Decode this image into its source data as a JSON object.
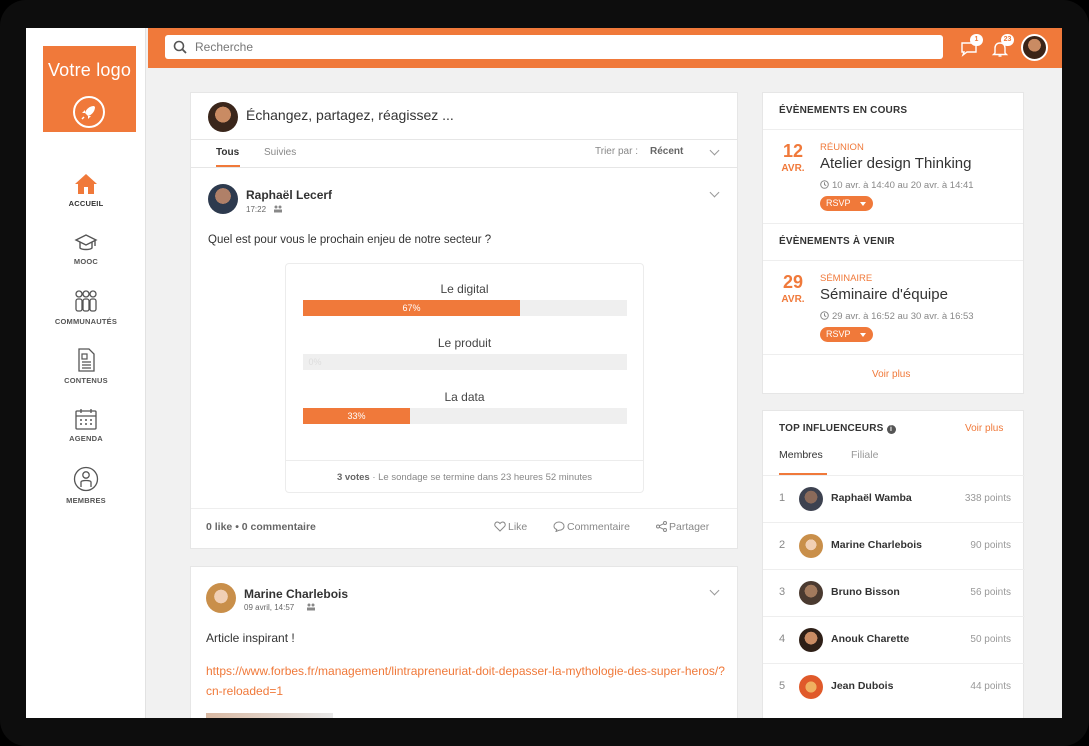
{
  "colors": {
    "accent": "#f0793a",
    "background": "#f1f1f1"
  },
  "sidebar": {
    "logo_text": "Votre logo",
    "logo_icon": "rocket-icon",
    "items": [
      {
        "label": "ACCUEIL",
        "icon": "home-icon",
        "active": true
      },
      {
        "label": "MOOC",
        "icon": "graduation-cap-icon"
      },
      {
        "label": "COMMUNAUTÉS",
        "icon": "people-icon"
      },
      {
        "label": "CONTENUS",
        "icon": "document-icon"
      },
      {
        "label": "AGENDA",
        "icon": "calendar-icon"
      },
      {
        "label": "MEMBRES",
        "icon": "user-icon"
      }
    ]
  },
  "topbar": {
    "search_placeholder": "Recherche",
    "messages_badge": "1",
    "notifications_badge": "23"
  },
  "composer": {
    "prompt": "Échangez, partagez, réagissez ..."
  },
  "feed_tabs": {
    "tabs": [
      "Tous",
      "Suivies"
    ],
    "active": "Tous",
    "sort_label": "Trier par :",
    "sort_value": "Récent"
  },
  "post1": {
    "author": "Raphaël Lecerf",
    "time": "17:22",
    "question": "Quel est pour vous le prochain enjeu de notre secteur ?",
    "poll": {
      "options": [
        {
          "label": "Le digital",
          "percent": 67,
          "percent_label": "67%"
        },
        {
          "label": "Le produit",
          "percent": 0,
          "percent_label": "0%"
        },
        {
          "label": "La data",
          "percent": 33,
          "percent_label": "33%"
        }
      ],
      "votes": "3 votes",
      "footer": " · Le sondage se termine dans 23 heures 52 minutes"
    },
    "stats": "0 like • 0 commentaire",
    "actions": {
      "like": "Like",
      "comment": "Commentaire",
      "share": "Partager"
    }
  },
  "post2": {
    "author": "Marine Charlebois",
    "time": "09 avril, 14:57",
    "text": "Article inspirant !",
    "link": "https://www.forbes.fr/management/lintrapreneuriat-doit-depasser-la-mythologie-des-super-heros/?cn-reloaded=1"
  },
  "events": {
    "current_title": "ÉVÈNEMENTS EN COURS",
    "upcoming_title": "ÉVÈNEMENTS À VENIR",
    "current": {
      "day": "12",
      "month": "AVR.",
      "type": "RÉUNION",
      "title": "Atelier design Thinking",
      "dates": "10 avr. à 14:40 au 20 avr. à 14:41",
      "rsvp": "RSVP"
    },
    "upcoming": {
      "day": "29",
      "month": "AVR.",
      "type": "SÉMINAIRE",
      "title": "Séminaire d'équipe",
      "dates": "29 avr. à 16:52 au 30 avr. à 16:53",
      "rsvp": "RSVP"
    },
    "see_more": "Voir plus"
  },
  "influencers": {
    "title": "TOP INFLUENCEURS",
    "see_more": "Voir plus",
    "tabs": [
      "Membres",
      "Filiale"
    ],
    "rows": [
      {
        "rank": "1",
        "name": "Raphaël Wamba",
        "points": "338 points"
      },
      {
        "rank": "2",
        "name": "Marine Charlebois",
        "points": "90 points"
      },
      {
        "rank": "3",
        "name": "Bruno Bisson",
        "points": "56 points"
      },
      {
        "rank": "4",
        "name": "Anouk Charette",
        "points": "50 points"
      },
      {
        "rank": "5",
        "name": "Jean Dubois",
        "points": "44 points"
      }
    ]
  }
}
